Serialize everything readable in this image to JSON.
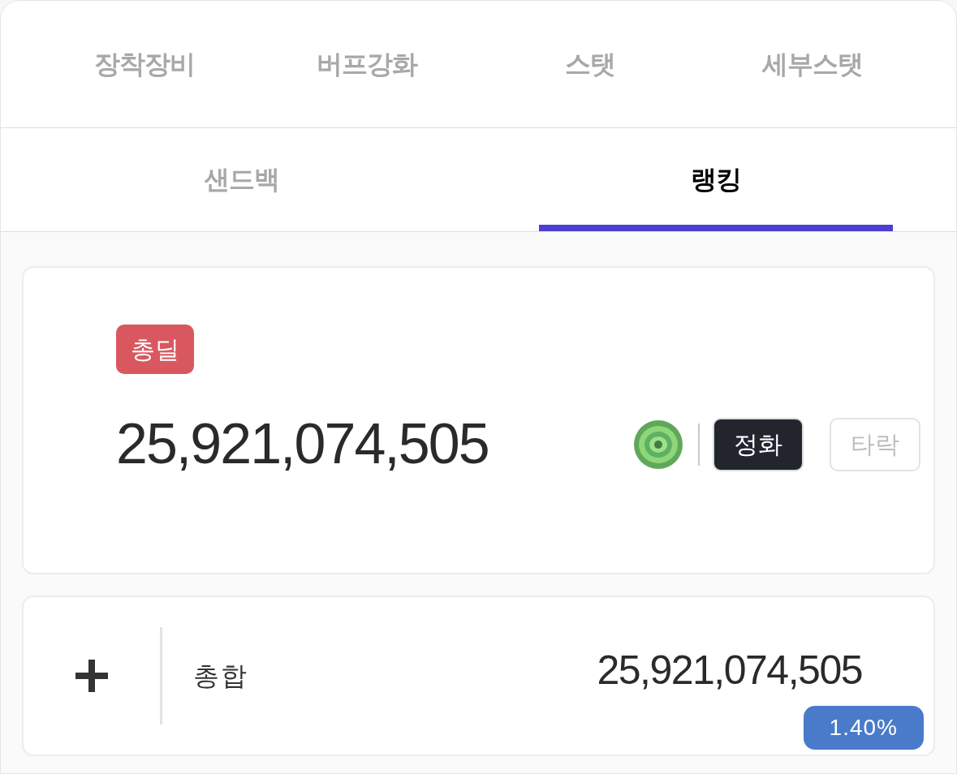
{
  "top_tabs": [
    {
      "label": "장착장비",
      "selected": false
    },
    {
      "label": "버프강화",
      "selected": false
    },
    {
      "label": "스탯",
      "selected": false
    },
    {
      "label": "세부스탯",
      "selected": false
    }
  ],
  "sub_tabs": [
    {
      "label": "샌드백",
      "selected": false
    },
    {
      "label": "랭킹",
      "selected": true
    }
  ],
  "summary": {
    "badge": "총딜",
    "value": "25,921,074,505",
    "modes": [
      {
        "label": "정화",
        "selected": true
      },
      {
        "label": "타락",
        "selected": false
      }
    ]
  },
  "rows": [
    {
      "expanded": false,
      "label": "총합",
      "value": "25,921,074,505",
      "percent": "1.40%"
    }
  ]
}
